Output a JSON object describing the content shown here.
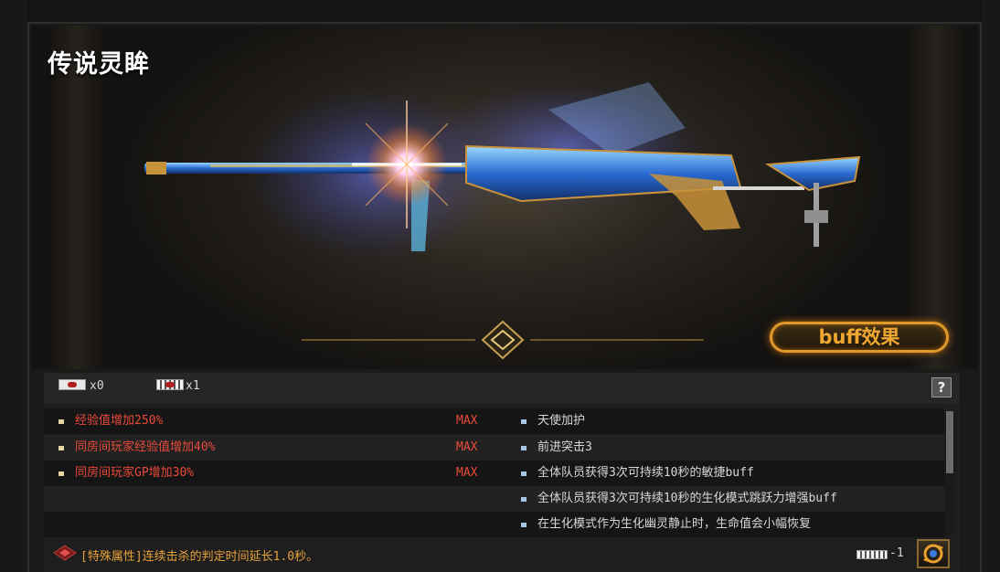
{
  "title": "传说灵眸",
  "buff_button_label": "buff效果",
  "cards": [
    {
      "icon": "card-a-icon",
      "count": "x0"
    },
    {
      "icon": "card-b-icon",
      "count": "x1"
    }
  ],
  "help_label": "?",
  "left_attributes": [
    {
      "text": "经验值增加250%",
      "level": "MAX"
    },
    {
      "text": "同房间玩家经验值增加40%",
      "level": "MAX"
    },
    {
      "text": "同房间玩家GP增加30%",
      "level": "MAX"
    }
  ],
  "right_attributes": [
    "天使加护",
    "前进突击3",
    "全体队员获得3次可持续10秒的敏捷buff",
    "全体队员获得3次可持续10秒的生化模式跳跃力增强buff",
    "在生化模式作为生化幽灵静止时，生命值会小幅恢复"
  ],
  "special_property": "[特殊属性]连续击杀的判定时间延长1.0秒。",
  "bottom_card_count": "-1",
  "colors": {
    "accent_gold": "#e19a2a",
    "attribute_red": "#e84a3a",
    "special_orange": "#e6a23a"
  }
}
